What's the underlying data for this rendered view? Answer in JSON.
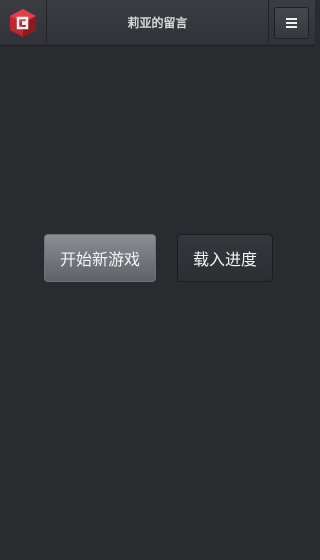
{
  "header": {
    "title": "莉亚的留言",
    "logo_icon": "red-cube-logo-icon",
    "menu_icon": "hamburger-menu-icon"
  },
  "main": {
    "new_game_label": "开始新游戏",
    "load_progress_label": "载入进度"
  },
  "colors": {
    "background": "#292b2f",
    "logo_red": "#c0262d"
  }
}
